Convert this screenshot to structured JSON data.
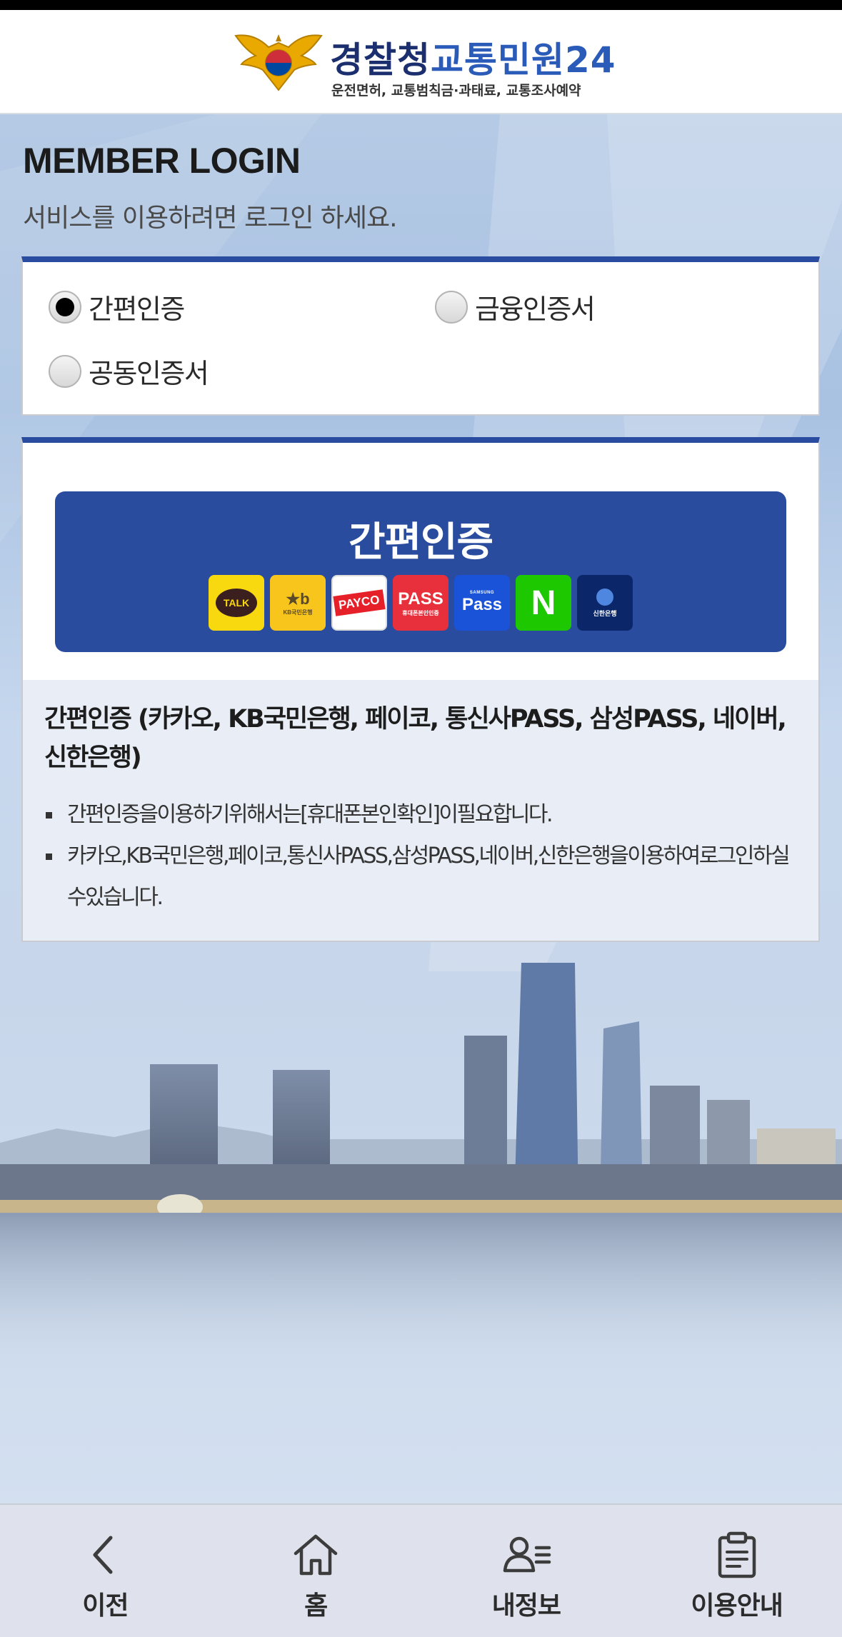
{
  "header": {
    "logo_title_part1": "경찰청",
    "logo_title_part2": "교통민원24",
    "logo_subtitle": "운전면허, 교통범칙금·과태료, 교통조사예약"
  },
  "page": {
    "title": "MEMBER LOGIN",
    "subtitle": "서비스를 이용하려면 로그인 하세요."
  },
  "login_methods": {
    "options": [
      {
        "label": "간편인증",
        "selected": true
      },
      {
        "label": "금융인증서",
        "selected": false
      },
      {
        "label": "공동인증서",
        "selected": false
      }
    ]
  },
  "easy_auth": {
    "button_label": "간편인증",
    "providers": [
      {
        "name": "kakao-icon",
        "text": "TALK"
      },
      {
        "name": "kb-icon",
        "text": "★b",
        "sub": "KB국민은행"
      },
      {
        "name": "payco-icon",
        "text": "PAYCO"
      },
      {
        "name": "pass-icon",
        "text": "PASS",
        "sub": "휴대폰본인인증"
      },
      {
        "name": "samsung-pass-icon",
        "text": "Pass",
        "sub": "SAMSUNG"
      },
      {
        "name": "naver-icon",
        "text": "N"
      },
      {
        "name": "shinhan-icon",
        "text": "신한은행"
      }
    ],
    "info_title": "간편인증 (카카오, KB국민은행, 페이코, 통신사PASS, 삼성PASS, 네이버, 신한은행)",
    "info_items": [
      "간편인증을이용하기위해서는[휴대폰본인확인]이필요합니다.",
      "카카오,KB국민은행,페이코,통신사PASS,삼성PASS,네이버,신한은행을이용하여로그인하실수있습니다."
    ]
  },
  "bottom_nav": {
    "items": [
      {
        "label": "이전",
        "icon": "back-icon"
      },
      {
        "label": "홈",
        "icon": "home-icon"
      },
      {
        "label": "내정보",
        "icon": "my-info-icon"
      },
      {
        "label": "이용안내",
        "icon": "guide-icon"
      }
    ]
  },
  "colors": {
    "brand_blue": "#2a4c9e",
    "box_border_top": "#2a4ca0",
    "info_bg": "#e9eef6",
    "nav_bg": "#dfe2ec"
  }
}
